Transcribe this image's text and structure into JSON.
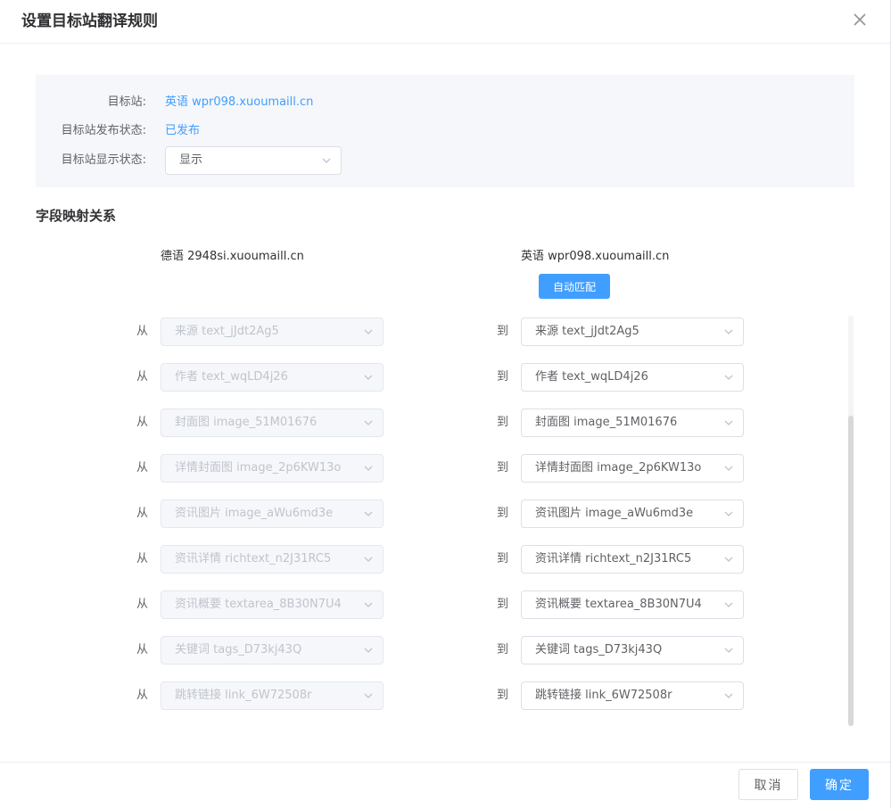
{
  "dialog": {
    "title": "设置目标站翻译规则"
  },
  "info": {
    "target_label": "目标站:",
    "target_value": "英语 wpr098.xuoumaill.cn",
    "publish_label": "目标站发布状态:",
    "publish_value": "已发布",
    "display_label": "目标站显示状态:",
    "display_value": "显示"
  },
  "mapping": {
    "title": "字段映射关系",
    "source_site": "德语 2948si.xuoumaill.cn",
    "target_site": "英语 wpr098.xuoumaill.cn",
    "auto_match_label": "自动匹配",
    "from_label": "从",
    "to_label": "到",
    "rows": [
      {
        "source": "来源 text_jJdt2Ag5",
        "target": "来源 text_jJdt2Ag5"
      },
      {
        "source": "作者 text_wqLD4j26",
        "target": "作者 text_wqLD4j26"
      },
      {
        "source": "封面图 image_51M01676",
        "target": "封面图 image_51M01676"
      },
      {
        "source": "详情封面图 image_2p6KW13o",
        "target": "详情封面图 image_2p6KW13o"
      },
      {
        "source": "资讯图片 image_aWu6md3e",
        "target": "资讯图片 image_aWu6md3e"
      },
      {
        "source": "资讯详情 richtext_n2J31RC5",
        "target": "资讯详情 richtext_n2J31RC5"
      },
      {
        "source": "资讯概要 textarea_8B30N7U4",
        "target": "资讯概要 textarea_8B30N7U4"
      },
      {
        "source": "关键词 tags_D73kj43Q",
        "target": "关键词 tags_D73kj43Q"
      },
      {
        "source": "跳转链接 link_6W72508r",
        "target": "跳转链接 link_6W72508r"
      }
    ]
  },
  "footer": {
    "cancel_label": "取消",
    "ok_label": "确定"
  }
}
